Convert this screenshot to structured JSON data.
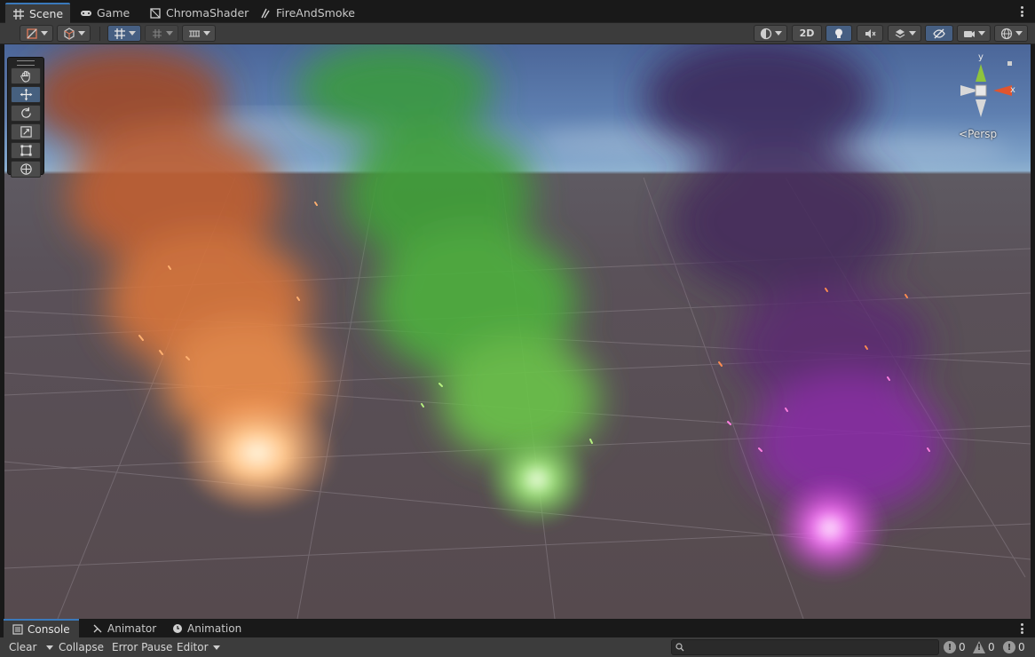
{
  "top_tabs": [
    {
      "label": "Scene",
      "icon": "grid-hash-icon"
    },
    {
      "label": "Game",
      "icon": "gamepad-icon"
    },
    {
      "label": "ChromaShader",
      "icon": "shader-icon"
    },
    {
      "label": "FireAndSmoke",
      "icon": "particle-system-icon"
    }
  ],
  "toolbar": {
    "mode_2d_label": "2D",
    "accent_color": "#465f82"
  },
  "tool_palette": [
    "hand-tool",
    "move-tool",
    "rotate-tool",
    "scale-tool",
    "rect-tool",
    "transform-tool"
  ],
  "gizmo": {
    "y_label": "y",
    "x_label": "x",
    "projection_label": "Persp"
  },
  "scene": {
    "smoke_colors": [
      "#e07a3c",
      "#4caf3a",
      "#8a2aa8"
    ]
  },
  "bottom_tabs": [
    {
      "label": "Console",
      "icon": "console-icon"
    },
    {
      "label": "Animator",
      "icon": "animator-icon"
    },
    {
      "label": "Animation",
      "icon": "animation-clock-icon"
    }
  ],
  "console": {
    "clear_label": "Clear",
    "collapse_label": "Collapse",
    "error_pause_label": "Error Pause",
    "editor_label": "Editor",
    "log_count": "0",
    "warning_count": "0",
    "error_count": "0"
  }
}
